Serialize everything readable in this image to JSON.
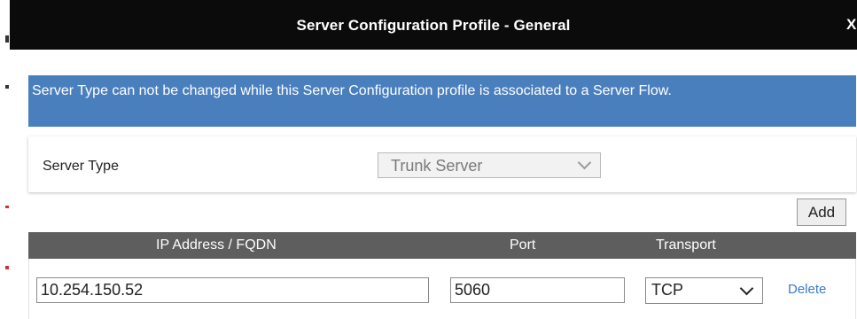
{
  "dialog": {
    "title": "Server Configuration Profile - General",
    "close_label": "X"
  },
  "info_banner": {
    "text": "Server Type can not be changed while this Server Configuration profile is associated to a Server Flow."
  },
  "form": {
    "server_type_label": "Server Type",
    "server_type_value": "Trunk Server"
  },
  "add_button_label": "Add",
  "table": {
    "columns": [
      "IP Address / FQDN",
      "Port",
      "Transport"
    ],
    "rows": [
      {
        "ip": "10.254.150.52",
        "port": "5060",
        "transport": "TCP",
        "action": "Delete"
      }
    ]
  },
  "colors": {
    "title_bar": "#0b0b0b",
    "info_banner": "#4a7fbe",
    "table_header": "#5e5e5e",
    "link": "#3a7bc8"
  }
}
